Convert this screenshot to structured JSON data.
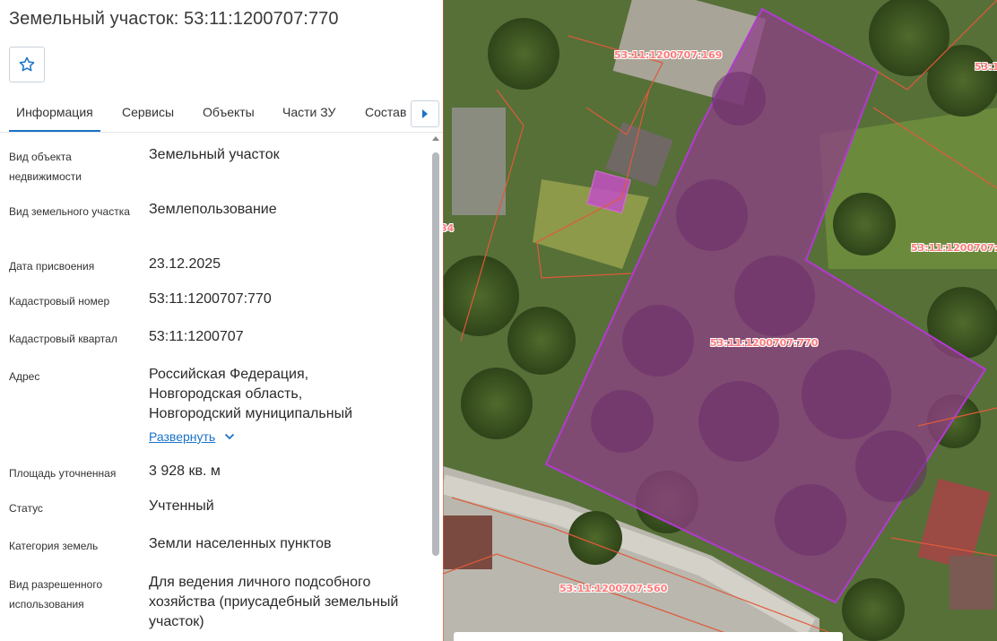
{
  "header": {
    "title": "Земельный участок: 53:11:1200707:770"
  },
  "tabs": [
    {
      "label": "Информация",
      "active": true
    },
    {
      "label": "Сервисы",
      "active": false
    },
    {
      "label": "Объекты",
      "active": false
    },
    {
      "label": "Части ЗУ",
      "active": false
    },
    {
      "label": "Состав",
      "active": false
    }
  ],
  "info": {
    "object_type": {
      "label": "Вид объекта недвижимости",
      "value": "Земельный участок"
    },
    "land_type": {
      "label": "Вид земельного участка",
      "value": "Землепользование"
    },
    "assigned_date": {
      "label": "Дата присвоения",
      "value": "23.12.2025"
    },
    "cadastral_number": {
      "label": "Кадастровый номер",
      "value": "53:11:1200707:770"
    },
    "cadastral_block": {
      "label": "Кадастровый квартал",
      "value": "53:11:1200707"
    },
    "address": {
      "label": "Адрес",
      "lines": [
        "Российская Федерация,",
        "Новгородская область,",
        "Новгородский муниципальный"
      ],
      "expand_label": "Развернуть"
    },
    "area": {
      "label": "Площадь уточненная",
      "value": "3 928 кв. м"
    },
    "status": {
      "label": "Статус",
      "value": "Учтенный"
    },
    "land_category": {
      "label": "Категория земель",
      "value": "Земли населенных пунктов"
    },
    "permitted_use": {
      "label": "Вид разрешенного использования",
      "value": "Для ведения личного подсобного хозяйства (приусадебный земельный участок)"
    }
  },
  "map": {
    "parcel_labels": {
      "selected": "53:11:1200707:770",
      "north": "53:11:1200707:169",
      "south": "53:11:1200707:560",
      "east": "53:11:1200707:",
      "top_right": "53:1",
      "top_partial": "53:11:1200707:169",
      "left_partial": "34"
    },
    "colors": {
      "selected_outline": "#b23ad2",
      "selected_fill": "#b04cc9",
      "neighbor_outline": "#e05a3a",
      "label_text": "#ff7a7a"
    }
  },
  "icons": {
    "favorite": "star-outline-icon",
    "tabs_next": "caret-right-icon",
    "expand": "chevron-down-icon"
  }
}
